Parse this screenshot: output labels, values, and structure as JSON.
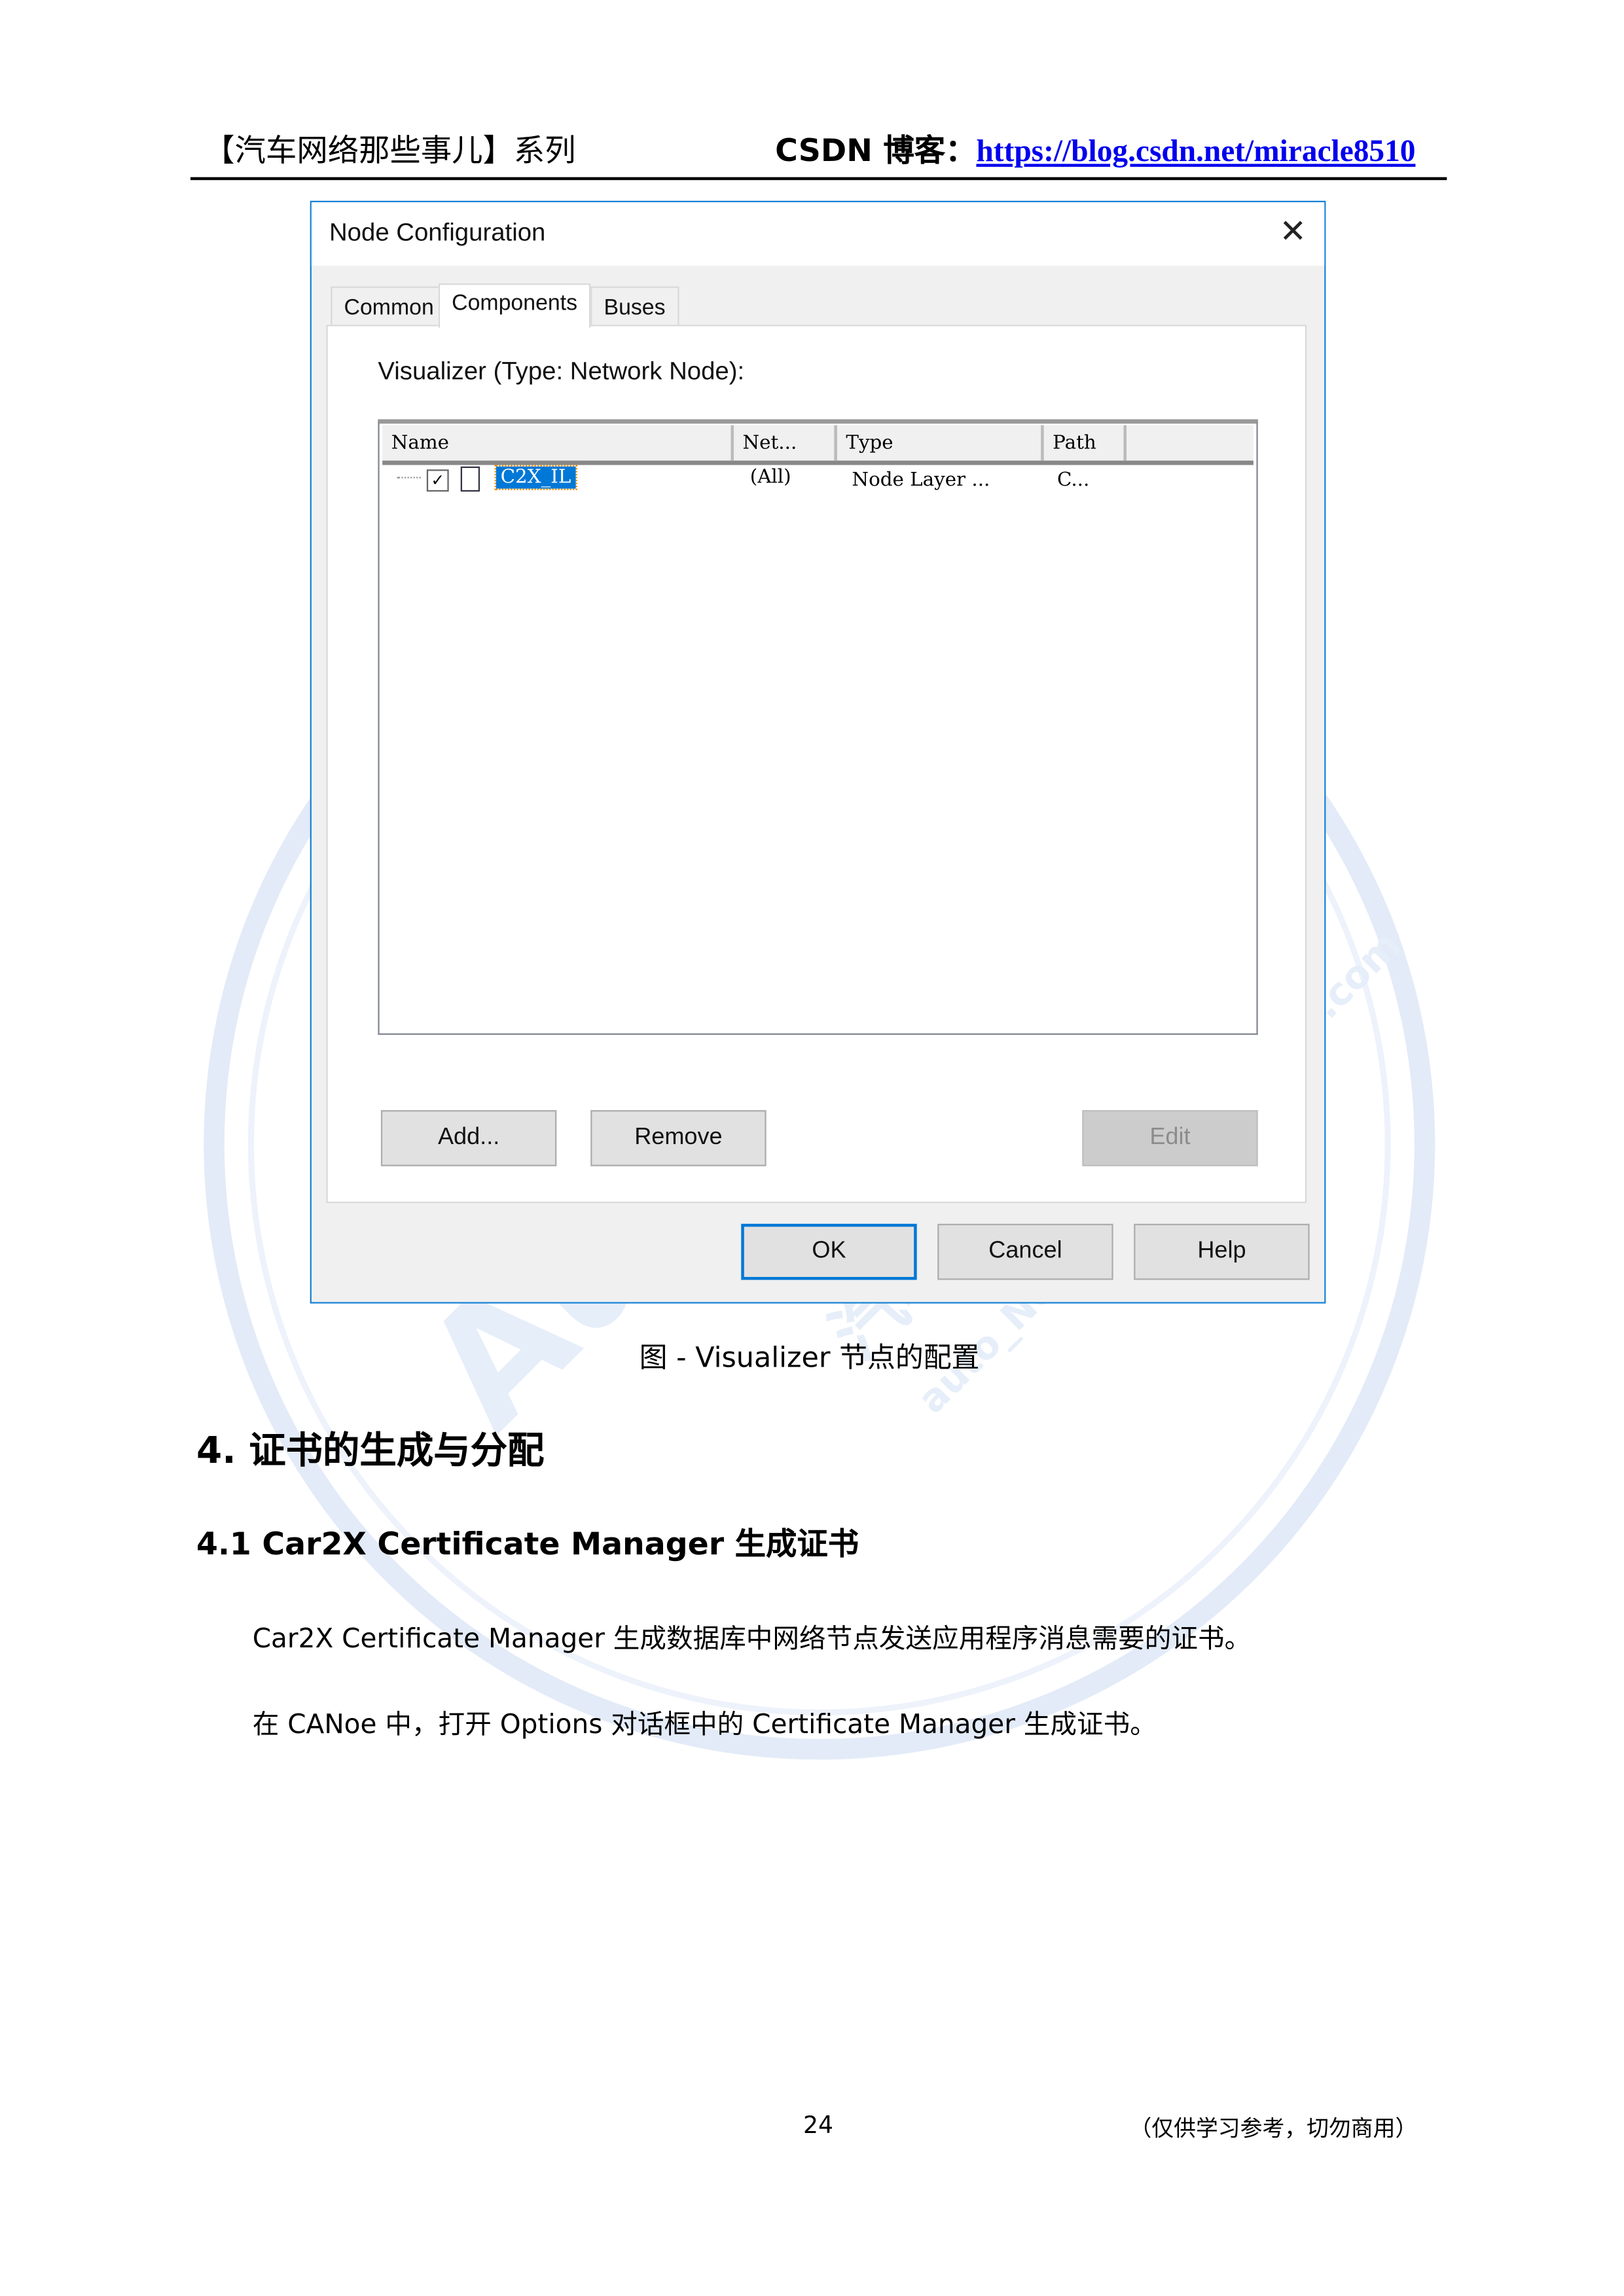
{
  "header": {
    "series_title": "【汽车网络那些事儿】系列",
    "blog_label": "CSDN 博客：",
    "blog_url": "https://blog.csdn.net/miracle8510"
  },
  "dialog": {
    "title": "Node Configuration",
    "close_icon": "close-icon",
    "tabs": [
      {
        "label": "Common",
        "selected": false
      },
      {
        "label": "Components",
        "selected": true
      },
      {
        "label": "Buses",
        "selected": false
      }
    ],
    "section_label": "Visualizer (Type: Network Node):",
    "columns": [
      "Name",
      "Net...",
      "Type",
      "Path"
    ],
    "rows": [
      {
        "checked": true,
        "name": "C2X_IL",
        "net": "(All)",
        "type": "Node Layer ...",
        "path": "C..."
      }
    ],
    "buttons": {
      "add": "Add...",
      "remove": "Remove",
      "edit": "Edit",
      "ok": "OK",
      "cancel": "Cancel",
      "help": "Help"
    },
    "accent_color": "#0078d7"
  },
  "caption": "图 - Visualizer 节点的配置",
  "section": {
    "heading": "4.  证书的生成与分配",
    "subheading": "4.1 Car2X Certificate Manager 生成证书",
    "paragraphs": [
      "Car2X Certificate Manager 生成数据库中网络节点发送应用程序消息需要的证书。",
      "在 CANoe 中，打开 Options 对话框中的 Certificate Manager 生成证书。"
    ]
  },
  "footer": {
    "page_number": "24",
    "notice": "（仅供学习参考，切勿商用）"
  },
  "watermark": {
    "text": "2019 Auto Know 汽车网络那些事 auto_net_know_how@163.com"
  }
}
